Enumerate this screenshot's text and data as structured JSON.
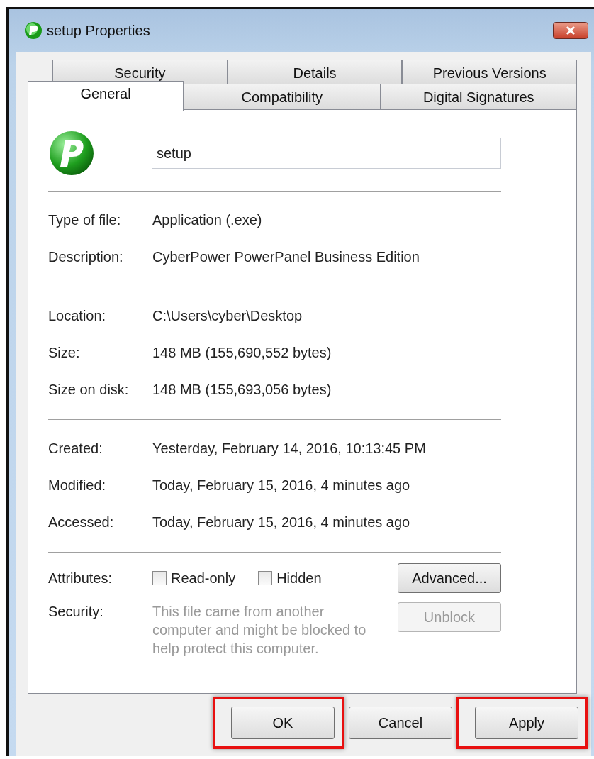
{
  "window": {
    "title": "setup Properties"
  },
  "tab_rows": [
    [
      {
        "label": "Security",
        "selected": false
      },
      {
        "label": "Details",
        "selected": false
      },
      {
        "label": "Previous Versions",
        "selected": false
      }
    ],
    [
      {
        "label": "General",
        "selected": true
      },
      {
        "label": "Compatibility",
        "selected": false
      },
      {
        "label": "Digital Signatures",
        "selected": false
      }
    ]
  ],
  "file_name": {
    "value": "setup"
  },
  "sections": [
    [
      {
        "label": "Type of file:",
        "value": "Application (.exe)"
      },
      {
        "label": "Description:",
        "value": "CyberPower PowerPanel Business Edition"
      }
    ],
    [
      {
        "label": "Location:",
        "value": "C:\\Users\\cyber\\Desktop"
      },
      {
        "label": "Size:",
        "value": "148 MB (155,690,552 bytes)"
      },
      {
        "label": "Size on disk:",
        "value": "148 MB (155,693,056 bytes)"
      }
    ],
    [
      {
        "label": "Created:",
        "value": "Yesterday, February 14, 2016, 10:13:45 PM"
      },
      {
        "label": "Modified:",
        "value": "Today, February 15, 2016, 4 minutes ago"
      },
      {
        "label": "Accessed:",
        "value": "Today, February 15, 2016, 4 minutes ago"
      }
    ]
  ],
  "attributes": {
    "label": "Attributes:",
    "checkboxes": [
      {
        "label": "Read-only",
        "checked": false
      },
      {
        "label": "Hidden",
        "checked": false
      }
    ],
    "button": {
      "label": "Advanced...",
      "disabled": false
    }
  },
  "security": {
    "label": "Security:",
    "text": "This file came from another computer and might be blocked to help protect this computer.",
    "button": {
      "label": "Unblock",
      "disabled": true
    }
  },
  "buttons": [
    {
      "label": "OK",
      "highlighted": true
    },
    {
      "label": "Cancel",
      "highlighted": false
    },
    {
      "label": "Apply",
      "highlighted": true
    }
  ]
}
